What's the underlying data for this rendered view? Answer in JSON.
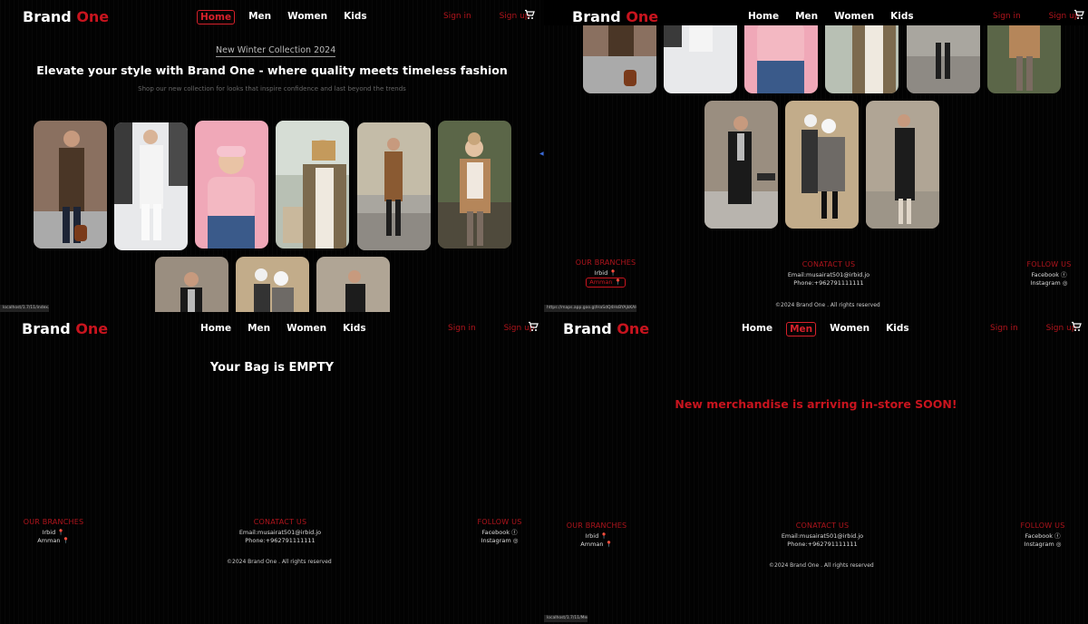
{
  "brand": {
    "part1": "Brand",
    "part2": "One"
  },
  "nav": {
    "home": "Home",
    "men": "Men",
    "women": "Women",
    "kids": "Kids"
  },
  "auth": {
    "signin": "Sign in",
    "signup": "Sign up"
  },
  "hero": {
    "pill": "New Winter Collection 2024",
    "title": "Elevate your style with Brand One - where quality meets timeless fashion",
    "subtitle": "Shop our new collection for looks that inspire confidence and last beyond the trends"
  },
  "bag": {
    "empty": "Your Bag is EMPTY"
  },
  "men_page": {
    "soon": "New merchandise is arriving in-store SOON!"
  },
  "footer": {
    "branches_title": "OUR BRANCHES",
    "branches": [
      "Irbid",
      "Amman"
    ],
    "contact_title": "CONATACT US",
    "email": "Email:musairat501@irbid.jo",
    "phone": "Phone:+962791111111",
    "follow_title": "FOLLOW US",
    "social": [
      "Facebook",
      "Instagram"
    ],
    "copyright": "©2024 Brand One . All rights reserved"
  },
  "status_bars": {
    "p1": "localhost/1.7/11/index.html",
    "p2": "https://maps.app.goo.gl/HaSdQ4HsBYAjkKAH9",
    "p4": "localhost/1.7/11/Men.html"
  },
  "colors": {
    "accent": "#c8141e",
    "background": "#000000",
    "text": "#ffffff"
  }
}
